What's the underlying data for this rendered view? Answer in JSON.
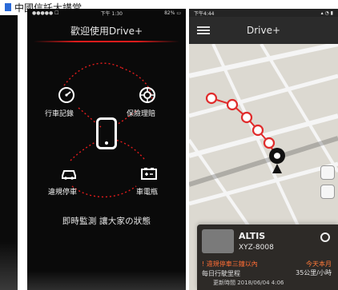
{
  "top_title": "中國信託大講堂",
  "mid": {
    "status": {
      "left": "●●●●● ☐",
      "center": "下午 1:30",
      "right": "82% ▭"
    },
    "header_title": "歡迎使用Drive+",
    "labels": {
      "tl": "行車記錄",
      "tr": "保險理賠",
      "bl": "違規停車",
      "br": "車電瓶"
    },
    "caption": "即時監測 讓大家の狀態",
    "icons": {
      "tl": "speedometer-icon",
      "tr": "tire-icon",
      "center": "phone-icon",
      "bl": "car-icon",
      "br": "battery-icon"
    },
    "accent": "#e41c1c"
  },
  "right": {
    "status": {
      "left": "下午4:44",
      "right": "▴ ◔ ▮"
    },
    "header_title": "Drive+",
    "card": {
      "title": "ALTIS",
      "plate": "XYZ-8008",
      "warning": "! 違規停車三鐘以內",
      "sub": "每日行駛里程",
      "right_key": "今天本月",
      "right_val": "35公里/小時",
      "bottom_time": "更新時間 2018/06/04 4:06"
    },
    "colors": {
      "route_red": "#e02b2b",
      "panel": "#2d2a27"
    }
  }
}
